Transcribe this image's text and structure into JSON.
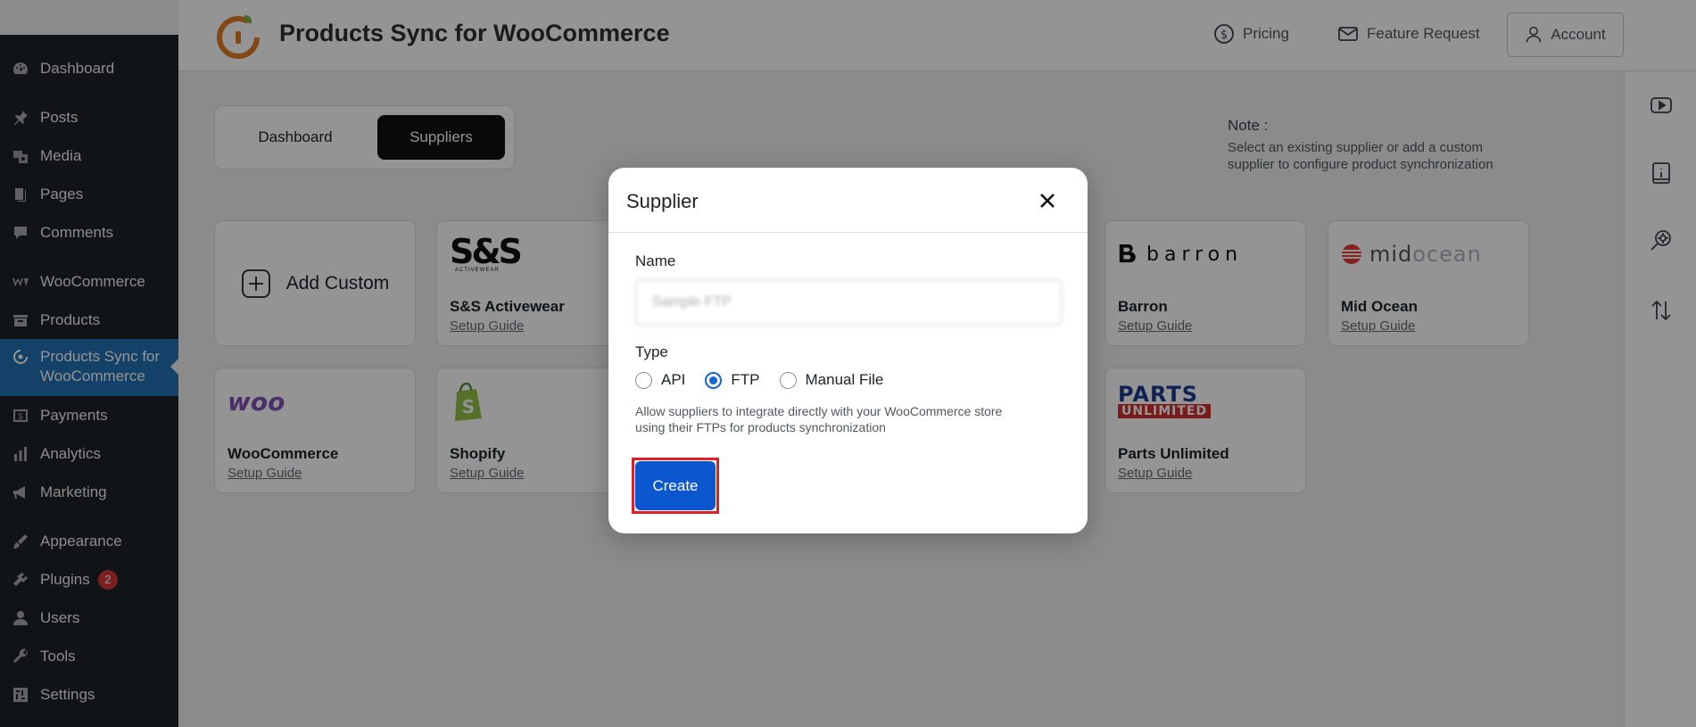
{
  "sidebar": {
    "items": [
      {
        "label": "Dashboard",
        "icon": "dashboard-icon"
      },
      {
        "label": "Posts",
        "icon": "pin-icon"
      },
      {
        "label": "Media",
        "icon": "media-icon"
      },
      {
        "label": "Pages",
        "icon": "pages-icon"
      },
      {
        "label": "Comments",
        "icon": "comment-icon"
      },
      {
        "label": "WooCommerce",
        "icon": "woo-icon"
      },
      {
        "label": "Products",
        "icon": "archive-icon"
      },
      {
        "label": "Products Sync for",
        "label2": "WooCommerce",
        "icon": "sync-icon"
      },
      {
        "label": "Payments",
        "icon": "dollar-icon"
      },
      {
        "label": "Analytics",
        "icon": "bar-chart-icon"
      },
      {
        "label": "Marketing",
        "icon": "megaphone-icon"
      },
      {
        "label": "Appearance",
        "icon": "brush-icon"
      },
      {
        "label": "Plugins",
        "icon": "plugin-icon",
        "badge": "2"
      },
      {
        "label": "Users",
        "icon": "user-icon"
      },
      {
        "label": "Tools",
        "icon": "wrench-icon"
      },
      {
        "label": "Settings",
        "icon": "settings-icon"
      }
    ]
  },
  "header": {
    "title": "Products Sync for WooCommerce",
    "pricing": "Pricing",
    "feature_request": "Feature Request",
    "account": "Account"
  },
  "tabs": {
    "dashboard": "Dashboard",
    "suppliers": "Suppliers"
  },
  "note": {
    "title": "Note :",
    "text": "Select an existing supplier or add a custom supplier to configure product synchronization"
  },
  "cards": {
    "add_custom": "Add Custom",
    "setup_guide": "Setup Guide",
    "ss": {
      "name": "S&S Activewear",
      "logo_text": "S&S",
      "logo_sub": "ACTIVEWEAR"
    },
    "barron": {
      "name": "Barron",
      "logo_text": "barron"
    },
    "midocean": {
      "name": "Mid Ocean",
      "logo_text_a": "mid",
      "logo_text_b": "ocean"
    },
    "woo": {
      "name": "WooCommerce",
      "logo_text": "woo"
    },
    "shopify": {
      "name": "Shopify"
    },
    "parts": {
      "name": "Parts Unlimited",
      "logo_text_a": "PARTS",
      "logo_text_b": "UNLIMITED"
    }
  },
  "modal": {
    "title": "Supplier",
    "name_label": "Name",
    "name_value": "Sample FTP",
    "type_label": "Type",
    "type_options": [
      "API",
      "FTP",
      "Manual File"
    ],
    "type_selected": "FTP",
    "type_help": "Allow suppliers to integrate directly with your WooCommerce store using their FTPs for products synchronization",
    "create": "Create"
  },
  "colors": {
    "admin_sidebar": "#1d2327",
    "active_menu": "#2271b1",
    "primary_button": "#0b57d0",
    "highlight": "#e01e27",
    "brand_orange": "#e07b24"
  }
}
